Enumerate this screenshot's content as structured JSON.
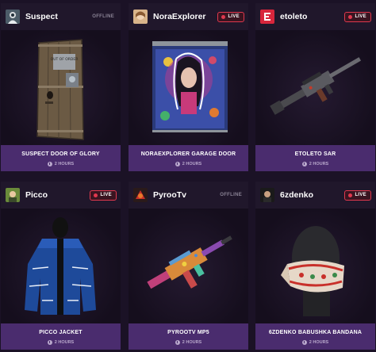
{
  "cards": [
    {
      "streamer": "Suspect",
      "status": "OFFLINE",
      "title": "SUSPECT DOOR OF GLORY",
      "duration": "2 HOURS",
      "avatar_icon": "streamer-avatar"
    },
    {
      "streamer": "NoraExplorer",
      "status": "LIVE",
      "title": "NORAEXPLORER GARAGE DOOR",
      "duration": "2 HOURS",
      "avatar_icon": "streamer-avatar"
    },
    {
      "streamer": "etoleto",
      "status": "LIVE",
      "title": "ETOLETO SAR",
      "duration": "2 HOURS",
      "avatar_icon": "e-logo"
    },
    {
      "streamer": "Picco",
      "status": "LIVE",
      "title": "PICCO JACKET",
      "duration": "2 HOURS",
      "avatar_icon": "streamer-avatar"
    },
    {
      "streamer": "PyrooTv",
      "status": "OFFLINE",
      "title": "PYROOTV MP5",
      "duration": "2 HOURS",
      "avatar_icon": "streamer-avatar"
    },
    {
      "streamer": "6zdenko",
      "status": "LIVE",
      "title": "6ZDENKO BABUSHKA BANDANA",
      "duration": "2 HOURS",
      "avatar_icon": "streamer-avatar"
    }
  ],
  "door_sign": "OUT OF ORDER",
  "colors": {
    "page_bg": "#1b1226",
    "header_bg": "#20172b",
    "footer_bg": "#4a2c6e",
    "live_red": "#e0384e"
  }
}
